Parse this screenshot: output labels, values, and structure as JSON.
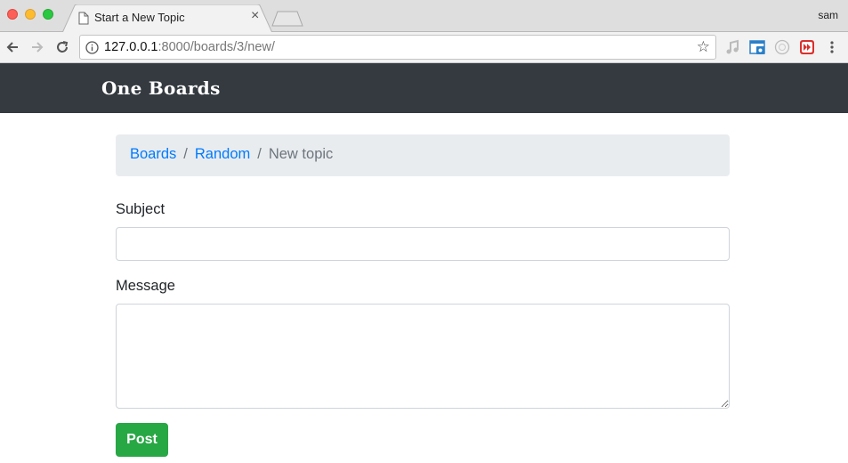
{
  "browser": {
    "tab_title": "Start a New Topic",
    "tab_close": "×",
    "user_name": "sam",
    "url_host": "127.0.0.1",
    "url_path": ":8000/boards/3/new/",
    "star": "☆"
  },
  "navbar": {
    "brand": "One Boards"
  },
  "breadcrumb": {
    "items": [
      {
        "label": "Boards"
      },
      {
        "label": "Random"
      }
    ],
    "separator": "/",
    "active": "New topic"
  },
  "form": {
    "subject_label": "Subject",
    "subject_value": "",
    "message_label": "Message",
    "message_value": "",
    "submit_label": "Post"
  },
  "colors": {
    "navbar_bg": "#343a40",
    "link": "#007bff",
    "success": "#28a745"
  }
}
